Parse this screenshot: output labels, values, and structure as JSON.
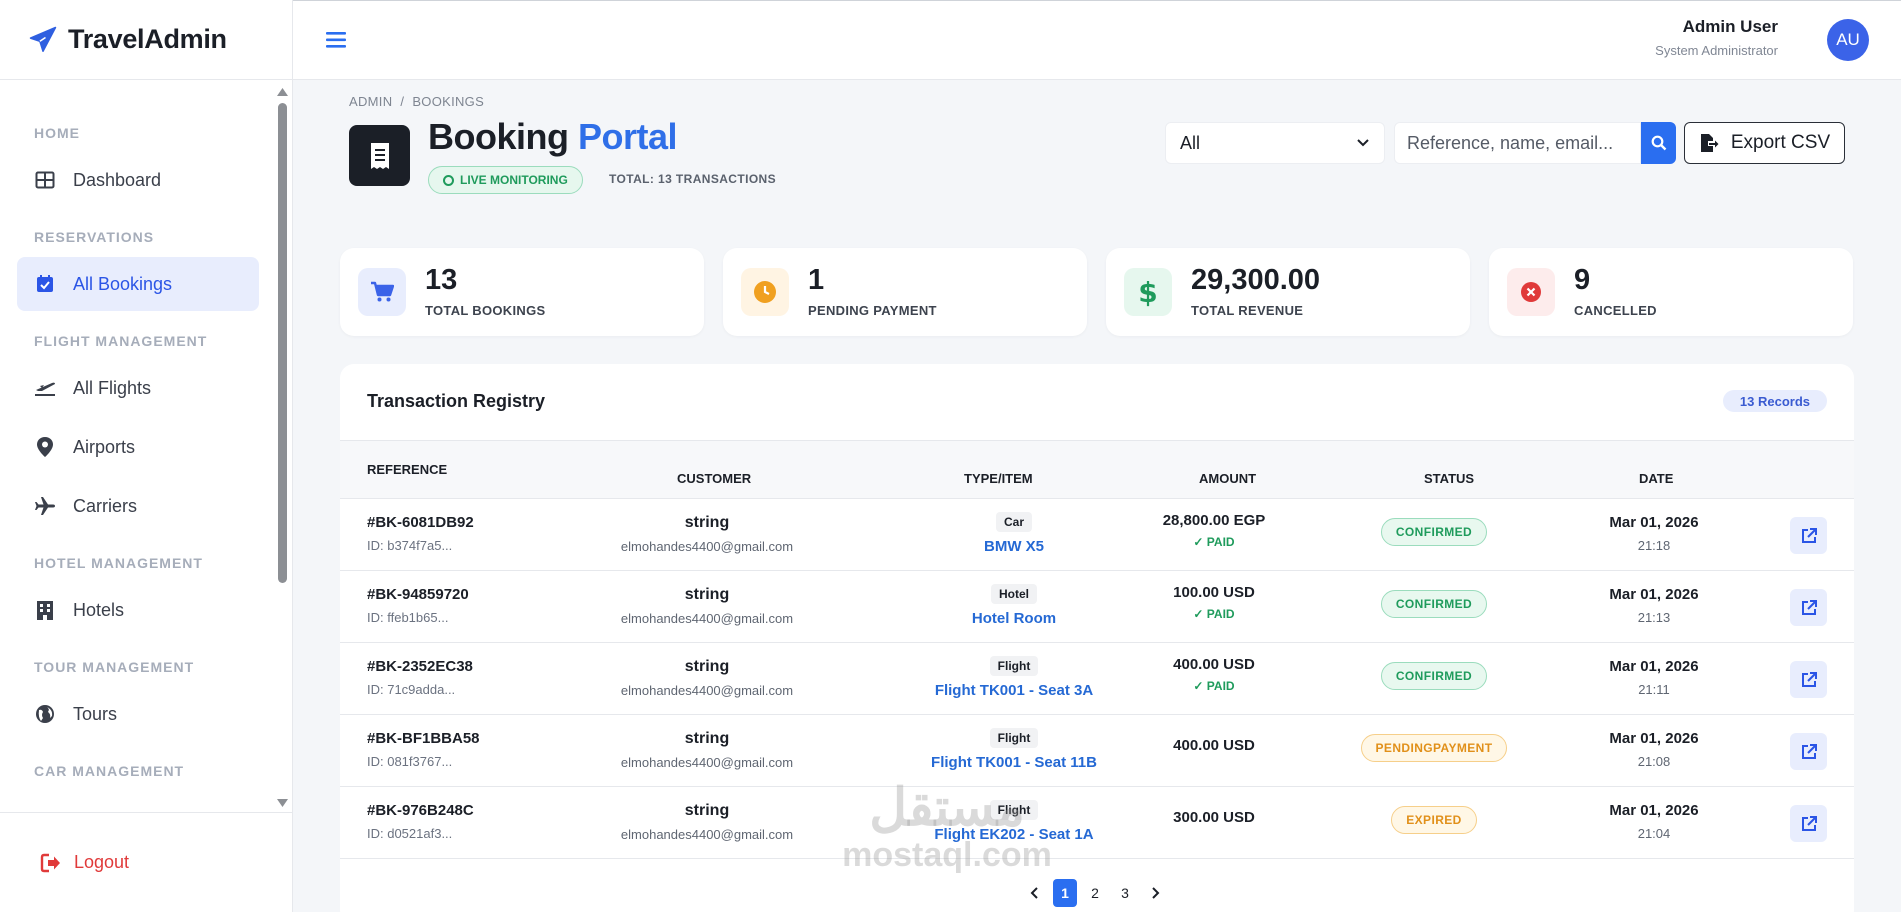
{
  "brand": {
    "name": "TravelAdmin"
  },
  "sidebar": {
    "sections": [
      {
        "title": "HOME",
        "items": [
          {
            "label": "Dashboard",
            "icon": "dashboard-icon"
          }
        ]
      },
      {
        "title": "RESERVATIONS",
        "items": [
          {
            "label": "All Bookings",
            "icon": "calendar-check-icon",
            "active": true
          }
        ]
      },
      {
        "title": "FLIGHT MANAGEMENT",
        "items": [
          {
            "label": "All Flights",
            "icon": "plane-departure-icon"
          },
          {
            "label": "Airports",
            "icon": "map-pin-icon"
          },
          {
            "label": "Carriers",
            "icon": "plane-icon"
          }
        ]
      },
      {
        "title": "HOTEL MANAGEMENT",
        "items": [
          {
            "label": "Hotels",
            "icon": "building-icon"
          }
        ]
      },
      {
        "title": "TOUR MANAGEMENT",
        "items": [
          {
            "label": "Tours",
            "icon": "globe-icon"
          }
        ]
      },
      {
        "title": "CAR MANAGEMENT",
        "items": []
      }
    ],
    "logout": "Logout"
  },
  "topbar": {
    "user_name": "Admin User",
    "user_role": "System Administrator",
    "avatar_initials": "AU"
  },
  "header": {
    "breadcrumb": [
      "ADMIN",
      "BOOKINGS"
    ],
    "title_main": "Booking",
    "title_accent": "Portal",
    "live_badge": "LIVE MONITORING",
    "total_transactions": "TOTAL: 13 TRANSACTIONS",
    "filter_value": "All",
    "search_placeholder": "Reference, name, email...",
    "export_label": "Export CSV"
  },
  "stats": [
    {
      "value": "13",
      "label": "TOTAL BOOKINGS",
      "icon": "cart-icon",
      "color": "#3b63e8",
      "bg": "#e8edfd"
    },
    {
      "value": "1",
      "label": "PENDING PAYMENT",
      "icon": "clock-icon",
      "color": "#f0a020",
      "bg": "#fff4e3"
    },
    {
      "value": "29,300.00",
      "label": "TOTAL REVENUE",
      "icon": "dollar-icon",
      "color": "#1f9b5c",
      "bg": "#e6f7ee"
    },
    {
      "value": "9",
      "label": "CANCELLED",
      "icon": "x-circle-icon",
      "color": "#e03a3a",
      "bg": "#fdecec"
    }
  ],
  "table": {
    "title": "Transaction Registry",
    "records_badge": "13 Records",
    "columns": [
      "REFERENCE",
      "CUSTOMER",
      "TYPE/ITEM",
      "AMOUNT",
      "STATUS",
      "DATE"
    ],
    "rows": [
      {
        "ref": "#BK-6081DB92",
        "id": "ID: b374f7a5...",
        "customer": "string",
        "email": "elmohandes4400@gmail.com",
        "type": "Car",
        "item": "BMW X5",
        "amount": "28,800.00 EGP",
        "paid": "PAID",
        "status": "CONFIRMED",
        "status_kind": "confirmed",
        "date": "Mar 01, 2026",
        "time": "21:18"
      },
      {
        "ref": "#BK-94859720",
        "id": "ID: ffeb1b65...",
        "customer": "string",
        "email": "elmohandes4400@gmail.com",
        "type": "Hotel",
        "item": "Hotel Room",
        "amount": "100.00 USD",
        "paid": "PAID",
        "status": "CONFIRMED",
        "status_kind": "confirmed",
        "date": "Mar 01, 2026",
        "time": "21:13"
      },
      {
        "ref": "#BK-2352EC38",
        "id": "ID: 71c9adda...",
        "customer": "string",
        "email": "elmohandes4400@gmail.com",
        "type": "Flight",
        "item": "Flight TK001 - Seat 3A",
        "amount": "400.00 USD",
        "paid": "PAID",
        "status": "CONFIRMED",
        "status_kind": "confirmed",
        "date": "Mar 01, 2026",
        "time": "21:11"
      },
      {
        "ref": "#BK-BF1BBA58",
        "id": "ID: 081f3767...",
        "customer": "string",
        "email": "elmohandes4400@gmail.com",
        "type": "Flight",
        "item": "Flight TK001 - Seat 11B",
        "amount": "400.00 USD",
        "paid": "",
        "status": "PENDINGPAYMENT",
        "status_kind": "pending",
        "date": "Mar 01, 2026",
        "time": "21:08"
      },
      {
        "ref": "#BK-976B248C",
        "id": "ID: d0521af3...",
        "customer": "string",
        "email": "elmohandes4400@gmail.com",
        "type": "Flight",
        "item": "Flight EK202 - Seat 1A",
        "amount": "300.00 USD",
        "paid": "",
        "status": "EXPIRED",
        "status_kind": "expired",
        "date": "Mar 01, 2026",
        "time": "21:04"
      }
    ]
  },
  "pagination": {
    "pages": [
      "1",
      "2",
      "3"
    ],
    "current": "1"
  },
  "watermark": {
    "arabic": "مستقل",
    "latin": "mostaql.com"
  }
}
